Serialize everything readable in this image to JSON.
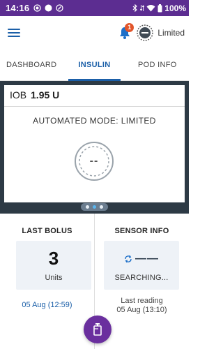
{
  "status_bar": {
    "time": "14:16",
    "battery": "100%",
    "icons": [
      "record-icon",
      "dot-icon",
      "notification-icon",
      "bluetooth-icon",
      "wifi-icon",
      "battery-icon"
    ]
  },
  "app_bar": {
    "menu_icon": "hamburger-menu-icon",
    "notification_count": "1",
    "mode_label": "Limited"
  },
  "tabs": [
    {
      "label": "DASHBOARD",
      "active": false
    },
    {
      "label": "INSULIN",
      "active": true
    },
    {
      "label": "POD INFO",
      "active": false
    }
  ],
  "insulin_panel": {
    "iob_label": "IOB",
    "iob_value": "1.95 U",
    "mode_text": "AUTOMATED MODE: LIMITED",
    "gauge_text": "--",
    "carousel_active_page": 2,
    "carousel_pages": 3
  },
  "last_bolus": {
    "title": "LAST BOLUS",
    "value": "3",
    "unit": "Units",
    "date": "05 Aug (12:59)"
  },
  "sensor_info": {
    "title": "SENSOR INFO",
    "value": "——",
    "status": "SEARCHING...",
    "last_reading_label": "Last reading",
    "last_reading_date": "05 Aug (13:10)"
  },
  "colors": {
    "brand_purple": "#5c2d91",
    "accent_blue": "#1b5fa8",
    "panel_dark": "#2d3a45",
    "badge_orange": "#e2552a"
  }
}
